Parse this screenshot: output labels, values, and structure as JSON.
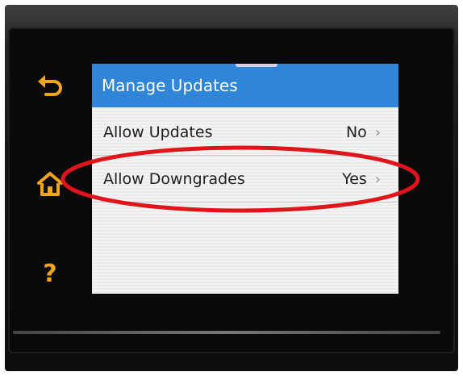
{
  "screen": {
    "title": "Manage Updates",
    "rows": [
      {
        "label": "Allow Updates",
        "value": "No",
        "chevron": "›"
      },
      {
        "label": "Allow Downgrades",
        "value": "Yes",
        "chevron": "›"
      }
    ]
  },
  "side_buttons": {
    "back": {
      "icon": "back-arrow-icon"
    },
    "home": {
      "icon": "home-icon"
    },
    "help": {
      "icon": "help-icon",
      "glyph": "?"
    }
  },
  "annotation": {
    "highlighted_row": "Allow Downgrades",
    "color": "#e0141b"
  },
  "colors": {
    "header_blue": "#2f86d9",
    "button_amber": "#f0a51e",
    "screen_bg": "#f4f4f4"
  }
}
